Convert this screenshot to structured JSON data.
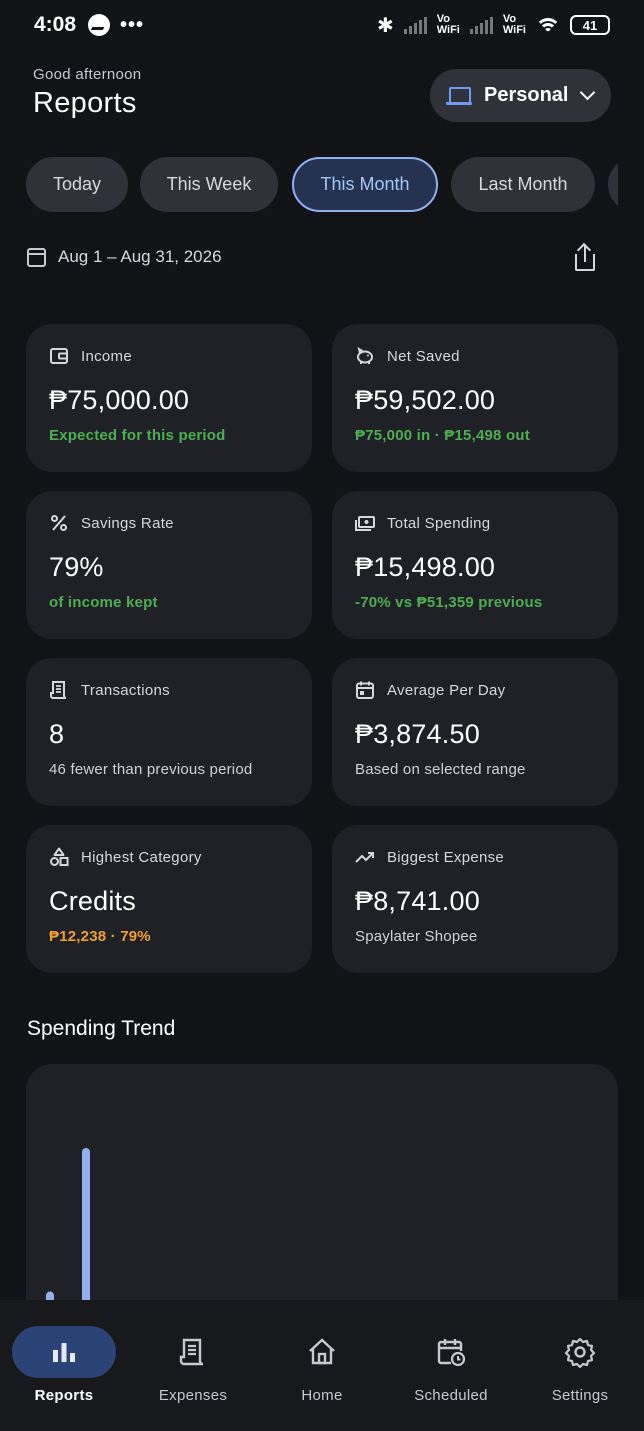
{
  "status_bar": {
    "time": "4:08",
    "dots": "•••",
    "vowifi": [
      "Vo",
      "WiFi"
    ],
    "battery": "41"
  },
  "header": {
    "greeting": "Good afternoon",
    "title": "Reports",
    "profile_label": "Personal"
  },
  "periods": {
    "items": [
      {
        "label": "Today"
      },
      {
        "label": "This Week"
      },
      {
        "label": "This Month",
        "selected": true
      },
      {
        "label": "Last Month"
      }
    ]
  },
  "date_range": {
    "label": "Aug 1 – Aug 31, 2026"
  },
  "cards": {
    "income": {
      "title": "Income",
      "value": "₱75,000.00",
      "sub": "Expected for this period"
    },
    "net_saved": {
      "title": "Net Saved",
      "value": "₱59,502.00",
      "sub": "₱75,000 in · ₱15,498 out"
    },
    "savings_rate": {
      "title": "Savings Rate",
      "value": "79%",
      "sub": "of income kept"
    },
    "total_spending": {
      "title": "Total Spending",
      "value": "₱15,498.00",
      "sub": "-70% vs ₱51,359 previous"
    },
    "transactions": {
      "title": "Transactions",
      "value": "8",
      "sub": "46 fewer than previous period"
    },
    "avg_per_day": {
      "title": "Average Per Day",
      "value": "₱3,874.50",
      "sub": "Based on selected range"
    },
    "highest_category": {
      "title": "Highest Category",
      "value": "Credits",
      "sub": "₱12,238 · 79%"
    },
    "biggest_expense": {
      "title": "Biggest Expense",
      "value": "₱8,741.00",
      "sub": "Spaylater Shopee"
    }
  },
  "trend": {
    "title": "Spending Trend"
  },
  "chart_data": {
    "type": "bar",
    "series": [
      {
        "values": [
          0.08,
          1
        ]
      }
    ],
    "colors": {
      "bar": "#8fb0ee"
    }
  },
  "nav": {
    "items": [
      {
        "label": "Reports",
        "icon": "bar-chart-icon",
        "active": true
      },
      {
        "label": "Expenses",
        "icon": "receipt-icon"
      },
      {
        "label": "Home",
        "icon": "home-icon"
      },
      {
        "label": "Scheduled",
        "icon": "calendar-clock-icon"
      },
      {
        "label": "Settings",
        "icon": "gear-icon"
      }
    ]
  },
  "colors": {
    "accent": "#8fb0ee",
    "positive": "#4caf50",
    "warning": "#f0a030",
    "background": "#111317",
    "card": "#1f2126"
  }
}
